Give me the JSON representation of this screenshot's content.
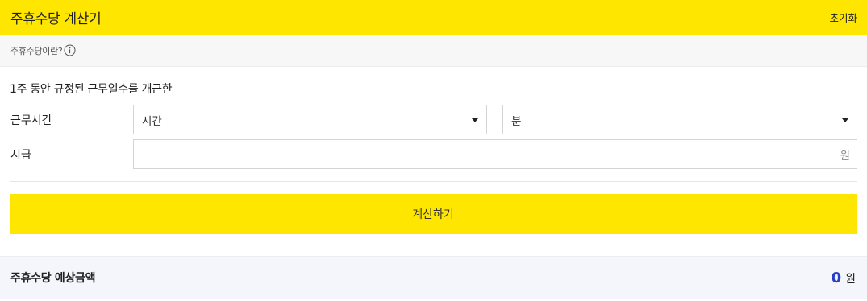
{
  "header": {
    "title": "주휴수당 계산기",
    "reset_label": "초기화"
  },
  "info": {
    "link_label": "주휴수당이란?",
    "icon": "info-circle-icon"
  },
  "form": {
    "description": "1주 동안 규정된 근무일수를 개근한",
    "hours_row": {
      "label": "근무시간",
      "hours_select": "시간",
      "minutes_select": "분"
    },
    "wage_row": {
      "label": "시급",
      "value": "",
      "unit": "원"
    },
    "calculate_label": "계산하기"
  },
  "result": {
    "label": "주휴수당 예상금액",
    "amount": "0",
    "unit": "원"
  },
  "colors": {
    "accent_yellow": "#ffe600",
    "result_blue": "#2a3fc7",
    "result_bg": "#f5f5fc"
  }
}
